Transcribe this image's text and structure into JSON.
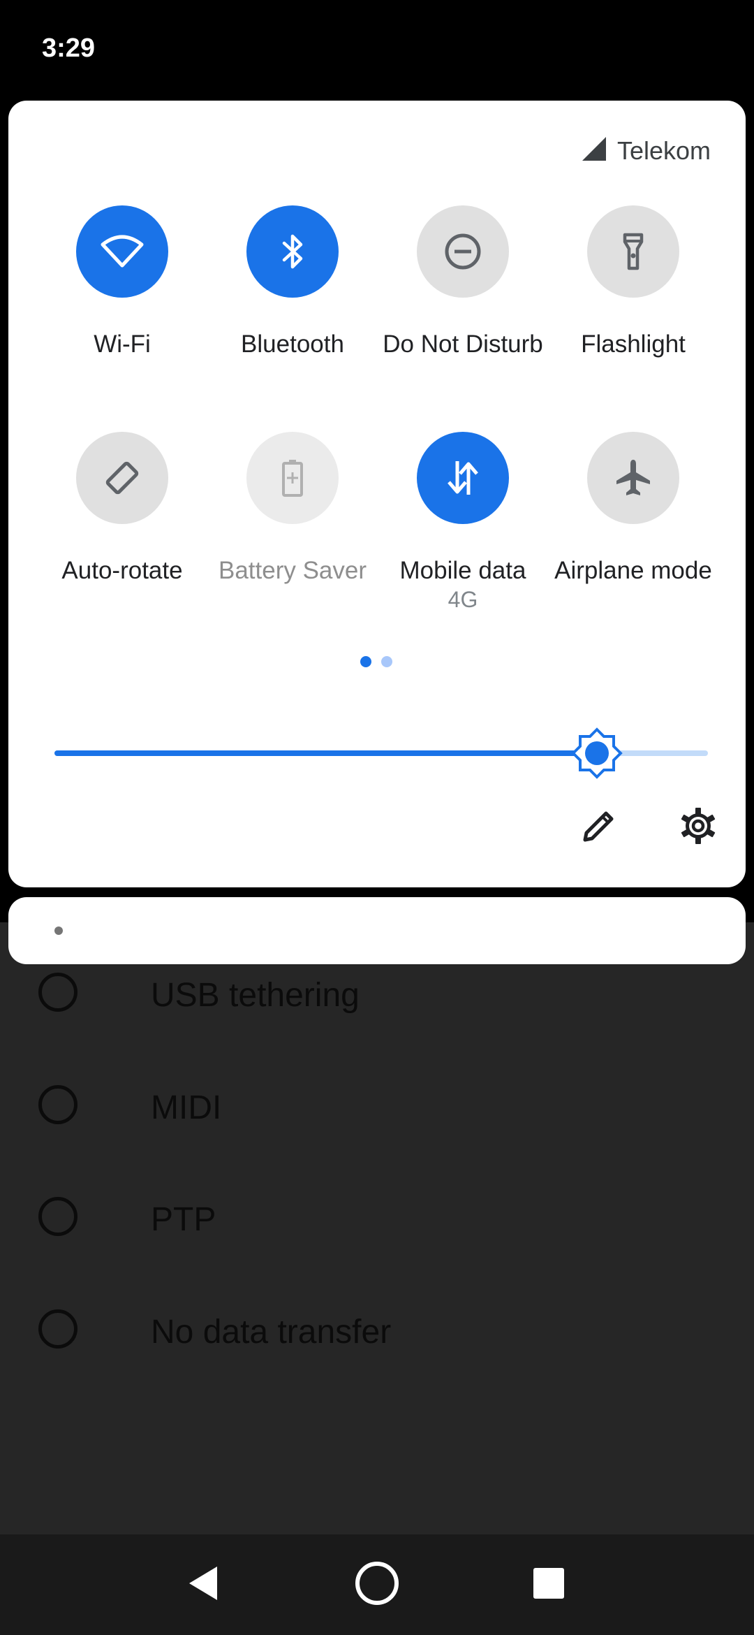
{
  "status_bar": {
    "time": "3:29"
  },
  "quick_settings": {
    "carrier": "Telekom",
    "tiles": [
      {
        "id": "wifi",
        "label": "Wi-Fi",
        "state": "on",
        "icon": "wifi-icon"
      },
      {
        "id": "bluetooth",
        "label": "Bluetooth",
        "state": "on",
        "icon": "bluetooth-icon"
      },
      {
        "id": "dnd",
        "label": "Do Not Disturb",
        "state": "off",
        "icon": "do-not-disturb-icon"
      },
      {
        "id": "flashlight",
        "label": "Flashlight",
        "state": "off",
        "icon": "flashlight-icon"
      },
      {
        "id": "autorotate",
        "label": "Auto-rotate",
        "state": "off",
        "icon": "auto-rotate-icon"
      },
      {
        "id": "battery-saver",
        "label": "Battery Saver",
        "state": "unavailable",
        "icon": "battery-saver-icon"
      },
      {
        "id": "mobile-data",
        "label": "Mobile data",
        "sublabel": "4G",
        "state": "on",
        "icon": "mobile-data-icon"
      },
      {
        "id": "airplane",
        "label": "Airplane mode",
        "state": "off",
        "icon": "airplane-icon"
      }
    ],
    "page_indicator": {
      "current": 1,
      "total": 2
    },
    "brightness": {
      "level_fraction": 0.83
    },
    "edit_icon": "pencil-icon",
    "settings_icon": "gear-icon"
  },
  "background_app": {
    "options": [
      {
        "label": "USB tethering"
      },
      {
        "label": "MIDI"
      },
      {
        "label": "PTP"
      },
      {
        "label": "No data transfer"
      }
    ]
  },
  "nav_bar": {
    "back_icon": "back-triangle-icon",
    "home_icon": "home-circle-icon",
    "recents_icon": "recents-square-icon"
  },
  "colors": {
    "accent": "#1a73e8",
    "tile_off": "#e0e0e0",
    "panel": "#ffffff",
    "scrim": "#262626"
  }
}
